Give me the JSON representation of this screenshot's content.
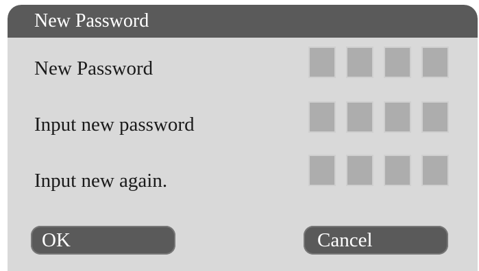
{
  "dialog": {
    "title": "New Password",
    "rows": [
      {
        "label": "New Password",
        "pin_digits": 4
      },
      {
        "label": "Input new password",
        "pin_digits": 4
      },
      {
        "label": "Input new again.",
        "pin_digits": 4
      }
    ],
    "buttons": {
      "ok_label": "OK",
      "cancel_label": "Cancel"
    }
  },
  "colors": {
    "dialog_background": "#d9d9d9",
    "title_bar": "#5a5a5a",
    "button": "#5a5a5a",
    "pin_box": "#adadad",
    "label_text": "#1a1a1a",
    "title_text": "#ffffff"
  }
}
